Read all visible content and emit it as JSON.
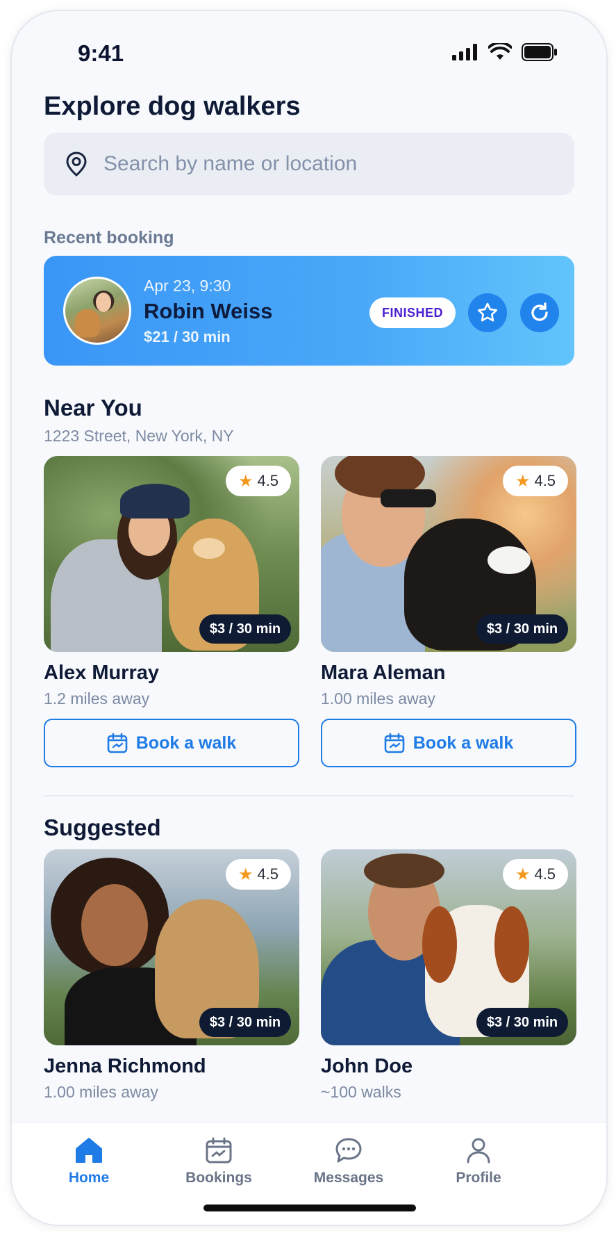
{
  "status_bar": {
    "time": "9:41"
  },
  "header": {
    "title": "Explore dog walkers"
  },
  "search": {
    "placeholder": "Search by name or location"
  },
  "recent_booking": {
    "label": "Recent booking",
    "date": "Apr 23, 9:30",
    "name": "Robin Weiss",
    "price": "$21 / 30 min",
    "status": "FINISHED"
  },
  "near_you": {
    "title": "Near You",
    "address": "1223 Street, New York, NY",
    "cards": [
      {
        "name": "Alex Murray",
        "distance": "1.2 miles away",
        "rating": "4.5",
        "price": "$3 / 30 min",
        "button": "Book a walk"
      },
      {
        "name": "Mara Aleman",
        "distance": "1.00 miles away",
        "rating": "4.5",
        "price": "$3 / 30 min",
        "button": "Book a walk"
      }
    ]
  },
  "suggested": {
    "title": "Suggested",
    "cards": [
      {
        "name": "Jenna Richmond",
        "distance": "1.00 miles away",
        "rating": "4.5",
        "price": "$3 / 30 min"
      },
      {
        "name": "John Doe",
        "distance": "~100 walks",
        "rating": "4.5",
        "price": "$3 / 30 min"
      }
    ]
  },
  "tabs": [
    {
      "label": "Home",
      "icon": "home-icon",
      "active": true
    },
    {
      "label": "Bookings",
      "icon": "calendar-icon",
      "active": false
    },
    {
      "label": "Messages",
      "icon": "chat-icon",
      "active": false
    },
    {
      "label": "Profile",
      "icon": "user-icon",
      "active": false
    }
  ],
  "colors": {
    "accent": "#1f7be6",
    "dark": "#0f1a36",
    "badge_text": "#4b1fcf",
    "star": "#f39a1e"
  }
}
